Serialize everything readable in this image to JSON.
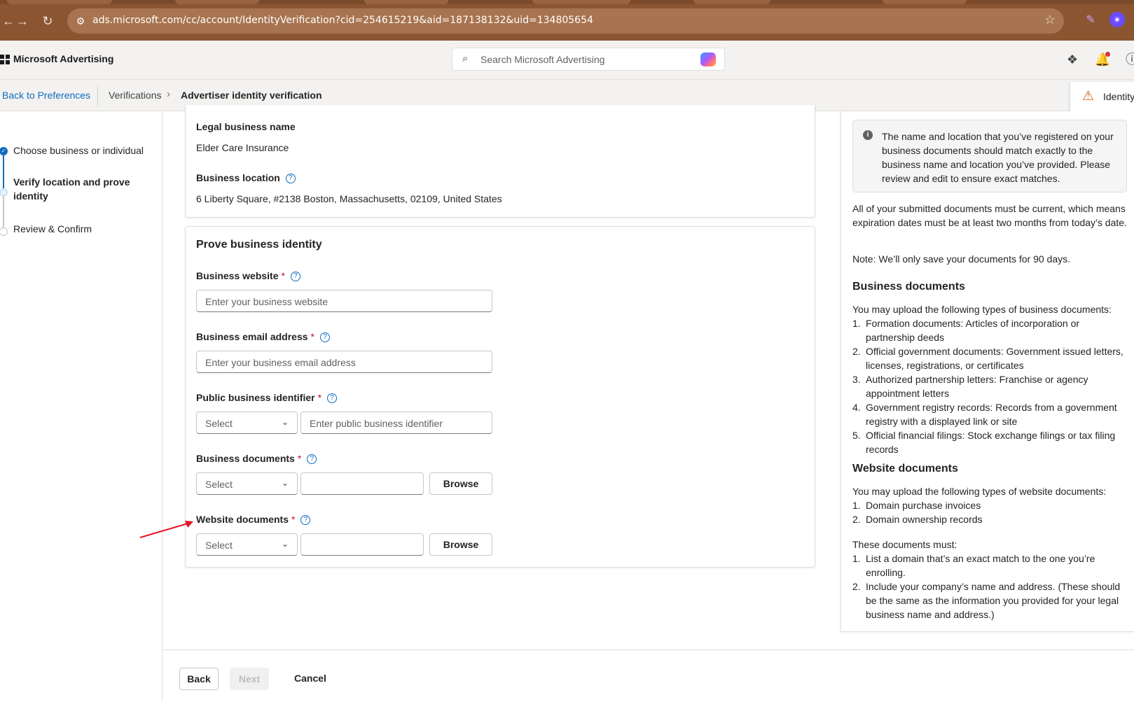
{
  "browser": {
    "url": "ads.microsoft.com/cc/account/IdentityVerification?cid=254615219&aid=187138132&uid=134805654"
  },
  "header": {
    "brand": "Microsoft Advertising",
    "search_placeholder": "Search Microsoft Advertising"
  },
  "breadcrumb": {
    "back": "Back to Preferences",
    "verifications": "Verifications",
    "current": "Advertiser identity verification",
    "warning_text": "Identity"
  },
  "stepper": {
    "steps": [
      {
        "label": "Choose business or individual",
        "state": "done"
      },
      {
        "label": "Verify location and prove identity",
        "state": "active"
      },
      {
        "label": "Review & Confirm",
        "state": "todo"
      }
    ]
  },
  "business_info": {
    "legal_name_label": "Legal business name",
    "legal_name_value": "Elder Care Insurance",
    "location_label": "Business location",
    "location_value": "6 Liberty Square, #2138 Boston, Massachusetts, 02109, United States"
  },
  "prove_identity": {
    "title": "Prove business identity",
    "required_mark": "*",
    "website": {
      "label": "Business website",
      "placeholder": "Enter your business website"
    },
    "email": {
      "label": "Business email address",
      "placeholder": "Enter your business email address"
    },
    "identifier": {
      "label": "Public business identifier",
      "select": "Select",
      "placeholder": "Enter public business identifier"
    },
    "business_docs": {
      "label": "Business documents",
      "select": "Select",
      "browse": "Browse"
    },
    "website_docs": {
      "label": "Website documents",
      "select": "Select",
      "browse": "Browse"
    }
  },
  "info_panel": {
    "notice": "The name and location that you’ve registered on your business documents should match exactly to the business name and location you’ve provided. Please review and edit to ensure exact matches.",
    "current_docs": "All of your submitted documents must be current, which means expiration dates must be at least two months from today’s date.",
    "note": "Note: We’ll only save your documents for 90 days.",
    "business_heading": "Business documents",
    "business_intro": "You may upload the following types of business documents:",
    "business_items": [
      "Formation documents: Articles of incorporation or partnership deeds",
      "Official government documents: Government issued letters, licenses, registrations, or certificates",
      "Authorized partnership letters: Franchise or agency appointment letters",
      "Government registry records: Records from a government registry with a displayed link or site",
      "Official financial filings: Stock exchange filings or tax filing records"
    ],
    "website_heading": "Website documents",
    "website_intro": "You may upload the following types of website documents:",
    "website_items": [
      "Domain purchase invoices",
      "Domain ownership records"
    ],
    "must_intro": "These documents must:",
    "must_items": [
      "List a domain that’s an exact match to the one you’re enrolling.",
      "Include your company’s name and address. (These should be the same as the information you provided for your legal business name and address.)"
    ]
  },
  "footer": {
    "back": "Back",
    "next": "Next",
    "cancel": "Cancel"
  },
  "colors": {
    "chrome": "#8b5532",
    "accent": "#0f6cbd",
    "required": "#c50f1f",
    "annotation_arrow": "#e81123"
  }
}
